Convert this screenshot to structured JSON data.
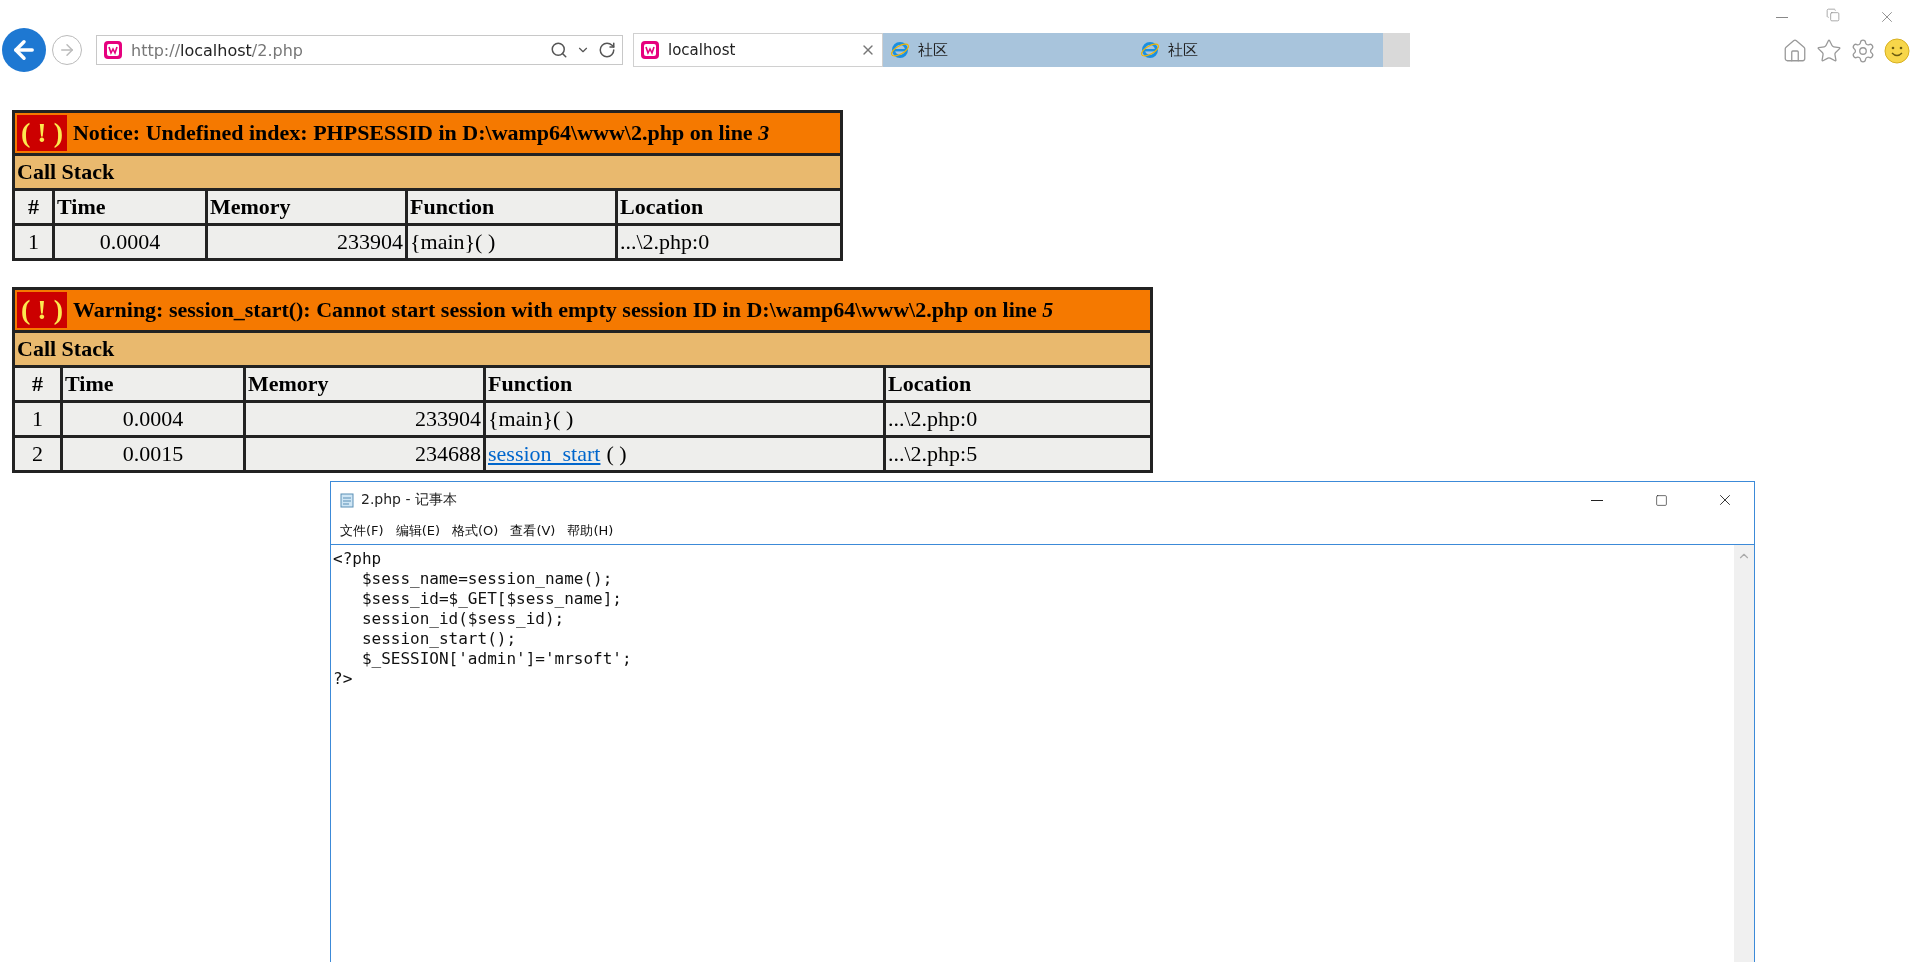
{
  "browser": {
    "address": {
      "scheme": "http://",
      "host": "localhost",
      "path": "/2.php"
    },
    "tabs": [
      {
        "label": "localhost",
        "selected": true,
        "kind": "local"
      },
      {
        "label": "社区",
        "selected": false,
        "kind": "web"
      },
      {
        "label": "社区",
        "selected": false,
        "kind": "web"
      }
    ]
  },
  "errors": [
    {
      "kind": "notice",
      "badge": "( ! )",
      "message": "Notice: Undefined index: PHPSESSID in D:\\wamp64\\www\\2.php on line *3*",
      "call_stack_title": "Call Stack",
      "columns": [
        "#",
        "Time",
        "Memory",
        "Function",
        "Location"
      ],
      "rows": [
        {
          "index": "1",
          "time": "0.0004",
          "memory": "233904",
          "function": "{main}",
          "args": "( )",
          "link": false,
          "location": "...\\2.php:0"
        }
      ]
    },
    {
      "kind": "warning",
      "badge": "( ! )",
      "message": "Warning: session_start(): Cannot start session with empty session ID in D:\\wamp64\\www\\2.php on line *5*",
      "call_stack_title": "Call Stack",
      "columns": [
        "#",
        "Time",
        "Memory",
        "Function",
        "Location"
      ],
      "rows": [
        {
          "index": "1",
          "time": "0.0004",
          "memory": "233904",
          "function": "{main}",
          "args": "( )",
          "link": false,
          "location": "...\\2.php:0"
        },
        {
          "index": "2",
          "time": "0.0015",
          "memory": "234688",
          "function": "session_start",
          "args": "( )",
          "link": true,
          "location": "...\\2.php:5"
        }
      ]
    }
  ],
  "notepad": {
    "title": "2.php - 记事本",
    "menu": [
      "文件(F)",
      "编辑(E)",
      "格式(O)",
      "查看(V)",
      "帮助(H)"
    ],
    "lines": [
      "<?php",
      "   $sess_name=session_name();",
      "   $sess_id=$_GET[$sess_name];",
      "   session_id($sess_id);",
      "   session_start();",
      "   $_SESSION['admin']='mrsoft';",
      "?>"
    ]
  }
}
